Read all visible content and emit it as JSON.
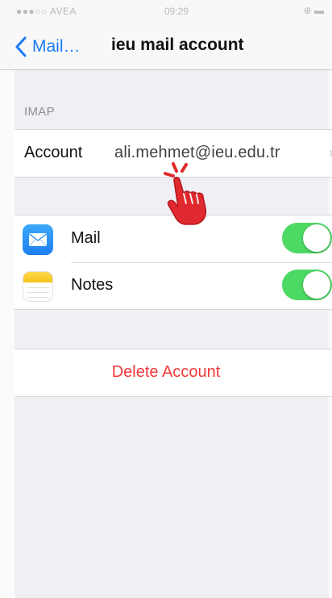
{
  "status_bar": {
    "carrier": "●●●○○ AVEA",
    "time": "09:29",
    "icons": "⊕ ▬"
  },
  "nav": {
    "back_label": "Mail…",
    "title": "ieu mail account"
  },
  "imap": {
    "header": "IMAP",
    "account_label": "Account",
    "account_value": "ali.mehmet@ieu.edu.tr",
    "chevron": "›"
  },
  "apps": [
    {
      "label": "Mail",
      "enabled": true
    },
    {
      "label": "Notes",
      "enabled": true
    }
  ],
  "delete_label": "Delete Account",
  "colors": {
    "accent": "#1a7cf5",
    "destructive": "#f23a3a",
    "toggle_on": "#4cd964",
    "pointer": "#e0292e"
  }
}
